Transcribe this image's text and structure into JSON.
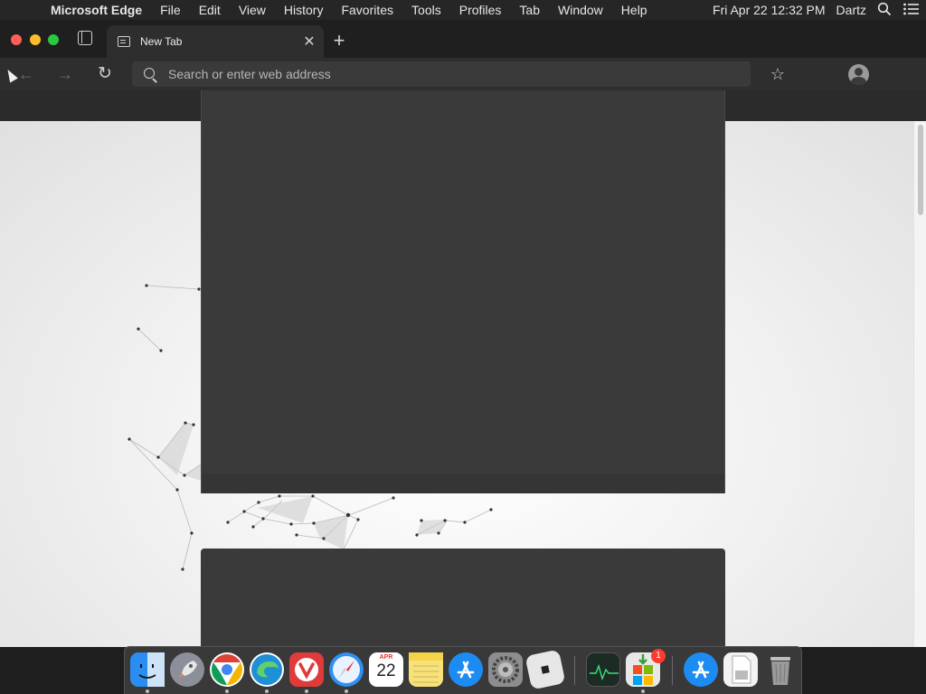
{
  "menubar": {
    "apple_icon": "apple-logo-icon",
    "app_name": "Microsoft Edge",
    "items": [
      "File",
      "Edit",
      "View",
      "History",
      "Favorites",
      "Tools",
      "Profiles",
      "Tab",
      "Window",
      "Help"
    ],
    "clock": "Fri Apr 22  12:32 PM",
    "user": "Dartz",
    "right_icons": [
      "spotlight-search-icon",
      "control-center-list-icon"
    ]
  },
  "window": {
    "traffic_lights": [
      "close",
      "minimize",
      "maximize"
    ],
    "traffic_colors": {
      "close": "#ff5f57",
      "minimize": "#febc2e",
      "maximize": "#28c840"
    }
  },
  "tabs": [
    {
      "title": "New Tab",
      "icon": "new-tab-page-icon",
      "active": true
    }
  ],
  "toolbar": {
    "back_glyph": "←",
    "forward_glyph": "→",
    "refresh_glyph": "↻",
    "address_placeholder": "Search or enter web address",
    "address_value": "",
    "favorites_glyph": "☆",
    "icons": [
      "back-arrow-icon",
      "forward-arrow-icon",
      "refresh-icon",
      "search-icon",
      "favorites-star-icon",
      "profile-avatar-icon"
    ]
  },
  "dock": {
    "apps": [
      {
        "name": "Finder",
        "running": true,
        "color": "#2a8df0"
      },
      {
        "name": "Launchpad",
        "running": false,
        "color": "#8a8f99"
      },
      {
        "name": "Google Chrome",
        "running": true,
        "color": "#e8453c"
      },
      {
        "name": "Microsoft Edge",
        "running": true,
        "color": "#1f8fd6"
      },
      {
        "name": "Vivaldi",
        "running": true,
        "color": "#e03b3b"
      },
      {
        "name": "Safari",
        "running": true,
        "color": "#2f8ff2"
      },
      {
        "name": "Calendar",
        "running": false,
        "color": "#ffffff",
        "month": "APR",
        "day": "22"
      },
      {
        "name": "Notes",
        "running": false,
        "color": "#f7e27a"
      },
      {
        "name": "App Store",
        "running": false,
        "color": "#1c8cf3"
      },
      {
        "name": "System Preferences",
        "running": false,
        "color": "#8d8d8d"
      },
      {
        "name": "Roblox",
        "running": false,
        "color": "#e6e6e6"
      },
      {
        "name": "Activity Monitor",
        "running": false,
        "color": "#1c2b24"
      },
      {
        "name": "Microsoft Installer",
        "running": true,
        "color": "#e8e8e8",
        "badge": "1"
      },
      {
        "name": "App Store Downloads",
        "running": false,
        "color": "#1c8cf3"
      },
      {
        "name": "Documents",
        "running": false,
        "color": "#d9d9d9"
      },
      {
        "name": "Trash",
        "running": false,
        "color": "#9a9a9a"
      }
    ]
  }
}
